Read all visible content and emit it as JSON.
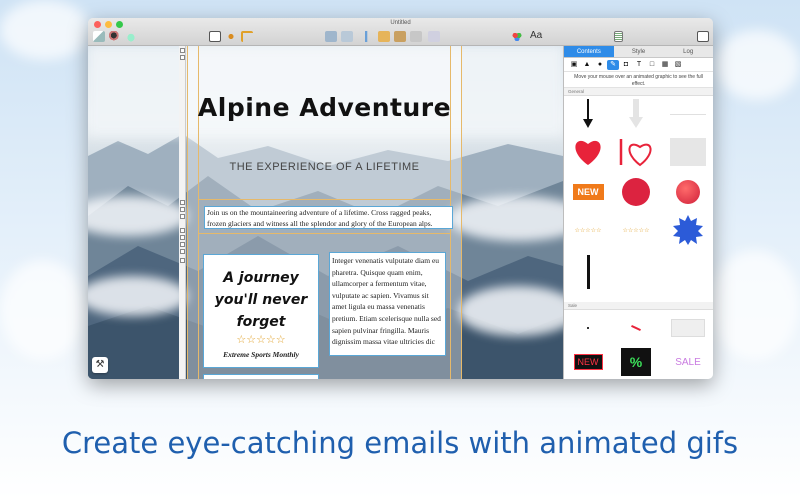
{
  "window": {
    "title": "Untitled"
  },
  "panel": {
    "tabs": [
      "Contents",
      "Style",
      "Log"
    ],
    "active_tab": "Contents",
    "hint": "Move your mouse over an animated graphic to see the full effect.",
    "sections": [
      "General",
      "Sale"
    ],
    "general_items": [
      "arrow-down-icon",
      "arrow-down-outline-icon",
      "line-icon",
      "heart-icon",
      "heart-outline-icon",
      "gray-box-icon",
      "new-badge",
      "red-circle",
      "red-sphere",
      "stars-row",
      "stars-row",
      "blue-starburst",
      "vertical-bar"
    ],
    "new_label": "NEW",
    "sale_items": [
      "dot-icon",
      "red-stroke-icon",
      "white-box-icon"
    ],
    "new_neon_label": "NEW",
    "percent_label": "%",
    "sale_label": "SALE"
  },
  "toolbar": {
    "font_label": "Aa"
  },
  "document": {
    "headline": "Alpine Adventure",
    "subhead": "THE EXPERIENCE OF A LIFETIME",
    "intro": "Join us on the mountaineering adventure of a lifetime. Cross ragged peaks, frozen glaciers and witness all the splendor and glory of the European alps.",
    "tagline": "A journey you'll never forget",
    "stars": "☆☆☆☆☆",
    "source": "Extreme Sports Monthly",
    "body": "Integer venenatis vulputate diam eu pharetra. Quisque quam enim, ullamcorper a fermentum vitae, vulputate ac sapien. Vivamus sit amet ligula eu massa venenatis pretium. Etiam scelerisque nulla sed sapien pulvinar fringilla. Mauris dignissim massa vitae ultricies dic"
  },
  "caption": "Create eye-catching emails with animated gifs",
  "colors": {
    "accent": "#2f8ce8",
    "caption": "#1f5fae",
    "guide": "#e6b96a"
  }
}
